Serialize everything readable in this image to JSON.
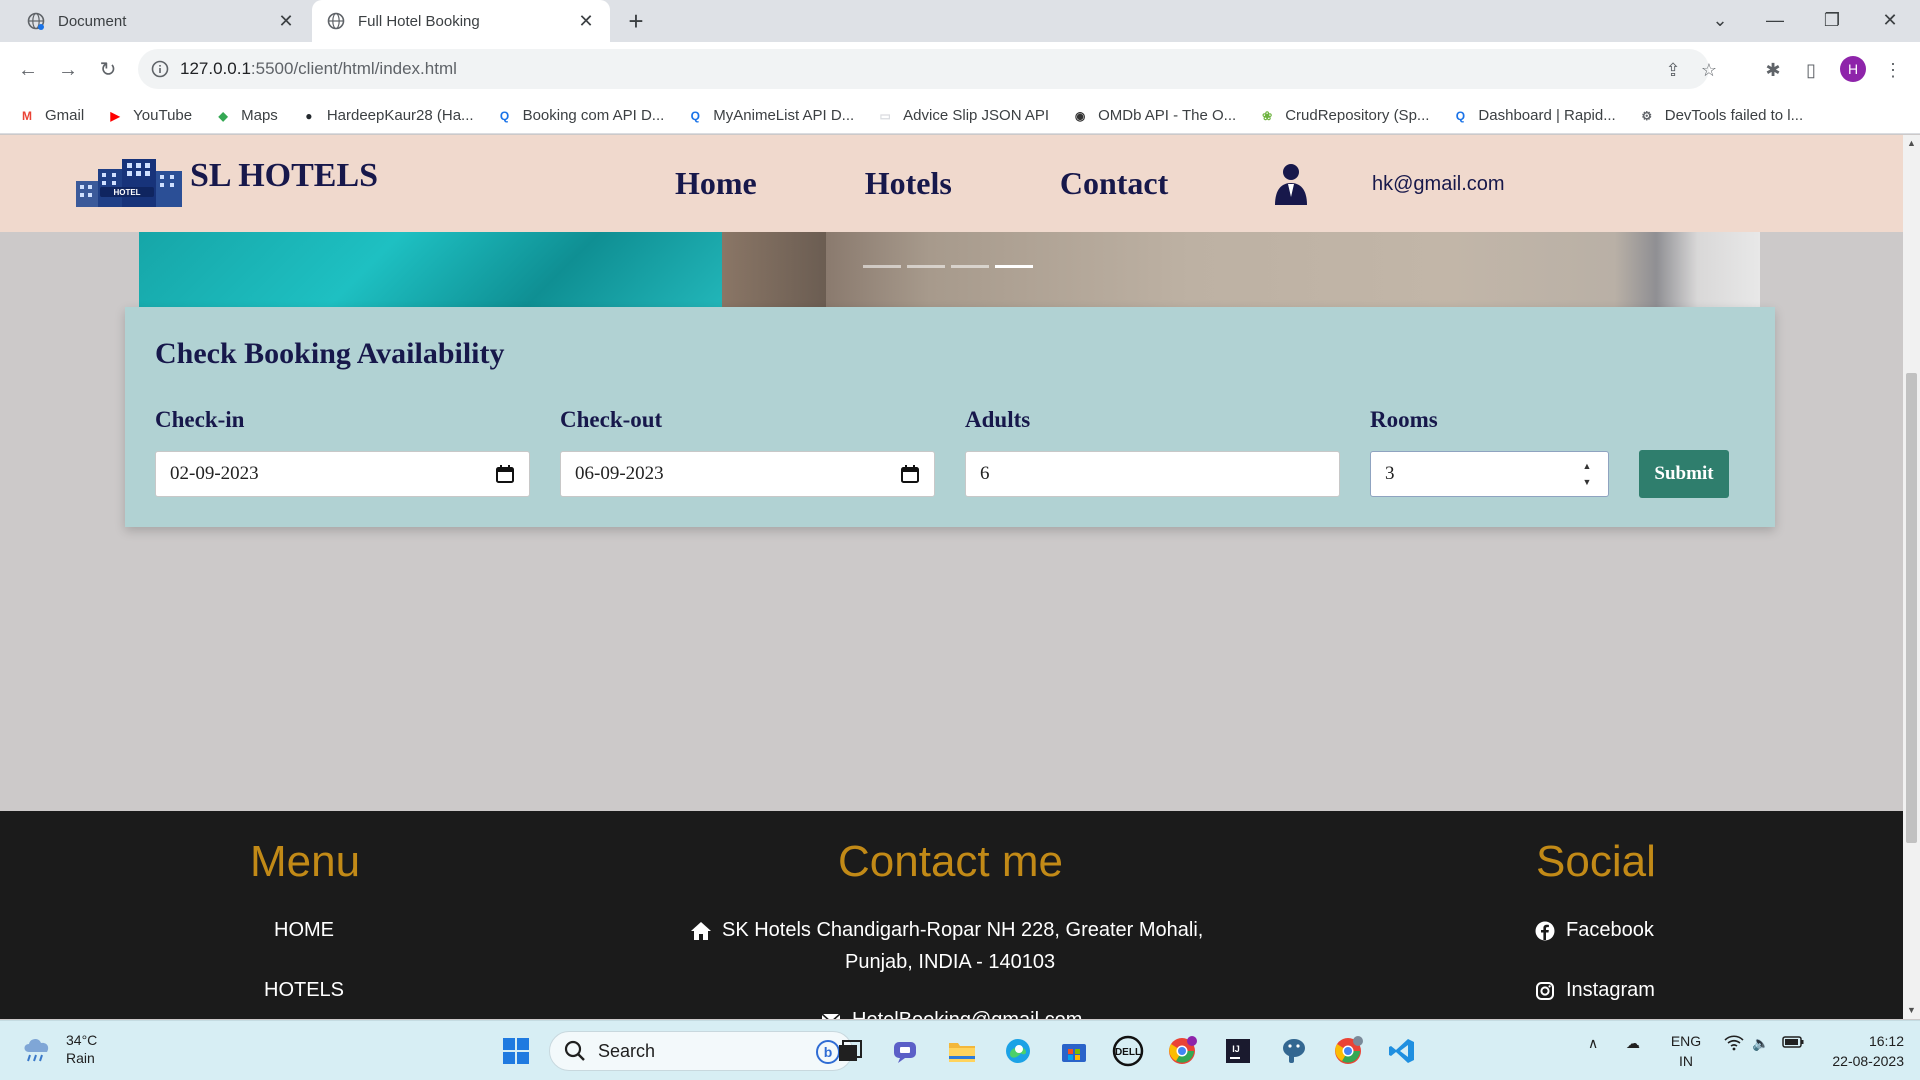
{
  "browser": {
    "tabs": [
      {
        "title": "Document",
        "active": false
      },
      {
        "title": "Full Hotel Booking",
        "active": true
      }
    ],
    "url_host": "127.0.0.1",
    "url_path": ":5500/client/html/index.html",
    "profile_initial": "H",
    "bookmarks": [
      {
        "label": "Gmail",
        "icon": "gmail-icon",
        "color": "#ea4335"
      },
      {
        "label": "YouTube",
        "icon": "youtube-icon",
        "color": "#ff0000"
      },
      {
        "label": "Maps",
        "icon": "maps-icon",
        "color": "#34a853"
      },
      {
        "label": "HardeepKaur28 (Ha...",
        "icon": "github-icon",
        "color": "#24292e"
      },
      {
        "label": "Booking com API D...",
        "icon": "rapidapi-icon",
        "color": "#1a73e8"
      },
      {
        "label": "MyAnimeList API D...",
        "icon": "rapidapi-icon",
        "color": "#1a73e8"
      },
      {
        "label": "Advice Slip JSON API",
        "icon": "blank-page-icon",
        "color": "#dadce0"
      },
      {
        "label": "OMDb API - The O...",
        "icon": "omdb-icon",
        "color": "#333333"
      },
      {
        "label": "CrudRepository (Sp...",
        "icon": "spring-icon",
        "color": "#6db33f"
      },
      {
        "label": "Dashboard | Rapid...",
        "icon": "rapidapi-icon",
        "color": "#1a73e8"
      },
      {
        "label": "DevTools failed to l...",
        "icon": "devtools-icon",
        "color": "#5f6368"
      }
    ]
  },
  "site": {
    "brand": "SL HOTELS",
    "logo_text": "HOTEL",
    "nav": [
      "Home",
      "Hotels",
      "Contact"
    ],
    "user_email": "hk@gmail.com",
    "carousel": {
      "slides": 4,
      "active_index": 3
    }
  },
  "booking": {
    "title": "Check Booking Availability",
    "checkin_label": "Check-in",
    "checkin_value": "02-09-2023",
    "checkout_label": "Check-out",
    "checkout_value": "06-09-2023",
    "adults_label": "Adults",
    "adults_value": "6",
    "rooms_label": "Rooms",
    "rooms_value": "3",
    "submit_label": "Submit"
  },
  "footer": {
    "menu_title": "Menu",
    "menu_items": [
      "HOME",
      "HOTELS"
    ],
    "contact_title": "Contact me",
    "address_line1": "SK Hotels Chandigarh-Ropar NH 228, Greater Mohali,",
    "address_line2": "Punjab, INDIA - 140103",
    "email": "HotelBooking@gmail.com",
    "social_title": "Social",
    "social_items": [
      "Facebook",
      "Instagram"
    ],
    "heading_color": "#c28a17"
  },
  "taskbar": {
    "temperature": "34°C",
    "condition": "Rain",
    "search_placeholder": "Search",
    "lang_line1": "ENG",
    "lang_line2": "IN",
    "time": "16:12",
    "date": "22-08-2023"
  },
  "colors": {
    "header_bg": "#f0d9cd",
    "navy": "#17184b",
    "booking_bg": "#b1d2d3",
    "submit_bg": "#2f7e6d",
    "footer_bg": "#1b1b1b"
  }
}
